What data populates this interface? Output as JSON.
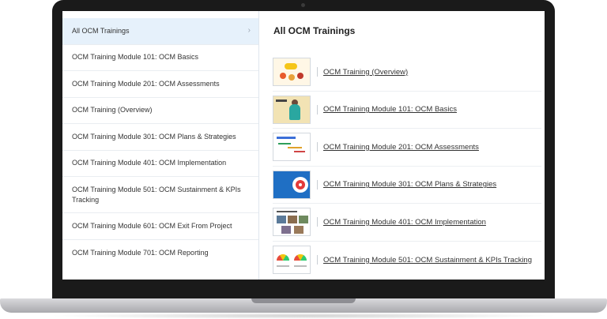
{
  "sidebar": {
    "items": [
      {
        "label": "All OCM Trainings"
      },
      {
        "label": "OCM Training Module 101: OCM Basics"
      },
      {
        "label": "OCM Training Module 201: OCM Assessments"
      },
      {
        "label": "OCM Training (Overview)"
      },
      {
        "label": "OCM Training Module 301: OCM Plans & Strategies"
      },
      {
        "label": "OCM Training Module 401: OCM Implementation"
      },
      {
        "label": "OCM Training Module 501: OCM Sustainment & KPIs Tracking"
      },
      {
        "label": "OCM Training Module 601: OCM Exit From Project"
      },
      {
        "label": "OCM Training Module 701: OCM Reporting"
      }
    ],
    "active_chevron": "›"
  },
  "main": {
    "title": "All OCM Trainings",
    "courses": [
      {
        "label": "OCM Training (Overview)",
        "thumb_icon": "training-overview-thumbnail"
      },
      {
        "label": "OCM Training Module 101: OCM Basics",
        "thumb_icon": "ocm-basics-thumbnail"
      },
      {
        "label": "OCM Training Module 201: OCM Assessments",
        "thumb_icon": "ocm-assessments-thumbnail"
      },
      {
        "label": "OCM Training Module 301: OCM Plans & Strategies",
        "thumb_icon": "target-thumbnail"
      },
      {
        "label": "OCM Training Module 401: OCM Implementation",
        "thumb_icon": "ocm-implementation-thumbnail"
      },
      {
        "label": "OCM Training Module 501: OCM Sustainment & KPIs Tracking",
        "thumb_icon": "gauge-thumbnail"
      }
    ]
  },
  "colors": {
    "active_item_bg": "#e6f1fb",
    "divider": "#dfe6ee",
    "laptop_bezel": "#1a1a1a"
  }
}
